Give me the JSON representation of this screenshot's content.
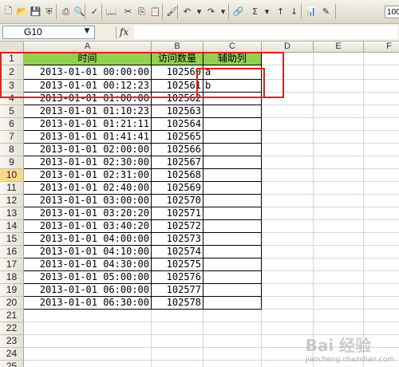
{
  "toolbar": {
    "buttons": [
      {
        "name": "new-icon",
        "glyph": "🗋"
      },
      {
        "name": "open-icon",
        "glyph": "📂"
      },
      {
        "name": "save-icon",
        "glyph": "💾"
      },
      {
        "name": "permission-icon",
        "glyph": "⛨"
      },
      {
        "name": "print-icon",
        "glyph": "⎙"
      },
      {
        "name": "print-preview-icon",
        "glyph": "🔍"
      },
      {
        "name": "spelling-icon",
        "glyph": "✓"
      },
      {
        "name": "research-icon",
        "glyph": "📖"
      },
      {
        "name": "cut-icon",
        "glyph": "✂"
      },
      {
        "name": "copy-icon",
        "glyph": "⎘"
      },
      {
        "name": "paste-icon",
        "glyph": "📋"
      },
      {
        "name": "format-painter-icon",
        "glyph": "🖌"
      },
      {
        "name": "undo-icon",
        "glyph": "↶"
      },
      {
        "name": "undo-dropdown-icon",
        "glyph": "▾"
      },
      {
        "name": "redo-icon",
        "glyph": "↷"
      },
      {
        "name": "redo-dropdown-icon",
        "glyph": "▾"
      },
      {
        "name": "hyperlink-icon",
        "glyph": "🔗"
      },
      {
        "name": "autosum-icon",
        "glyph": "Σ"
      },
      {
        "name": "autosum-dropdown-icon",
        "glyph": "▾"
      },
      {
        "name": "sort-ascending-icon",
        "glyph": "↑"
      },
      {
        "name": "sort-descending-icon",
        "glyph": "↓"
      },
      {
        "name": "chart-wizard-icon",
        "glyph": "📊"
      },
      {
        "name": "drawing-icon",
        "glyph": "✎"
      }
    ],
    "zoom": "100"
  },
  "formula_bar": {
    "name_box": "G10",
    "dropdown": "▼",
    "fx": "fx",
    "content": ""
  },
  "columns": [
    "A",
    "B",
    "C",
    "D",
    "E",
    "F"
  ],
  "headers": {
    "time": "时间",
    "visits": "访问数量",
    "helper": "辅助列"
  },
  "rows": [
    {
      "time": "2013-01-01 00:00:00",
      "visits": "102560",
      "helper": "a"
    },
    {
      "time": "2013-01-01 00:12:23",
      "visits": "102561",
      "helper": "b"
    },
    {
      "time": "2013-01-01 01:00:00",
      "visits": "102562",
      "helper": ""
    },
    {
      "time": "2013-01-01 01:10:23",
      "visits": "102563",
      "helper": ""
    },
    {
      "time": "2013-01-01 01:21:11",
      "visits": "102564",
      "helper": ""
    },
    {
      "time": "2013-01-01 01:41:41",
      "visits": "102565",
      "helper": ""
    },
    {
      "time": "2013-01-01 02:00:00",
      "visits": "102566",
      "helper": ""
    },
    {
      "time": "2013-01-01 02:30:00",
      "visits": "102567",
      "helper": ""
    },
    {
      "time": "2013-01-01 02:31:00",
      "visits": "102568",
      "helper": ""
    },
    {
      "time": "2013-01-01 02:40:00",
      "visits": "102569",
      "helper": ""
    },
    {
      "time": "2013-01-01 03:00:00",
      "visits": "102570",
      "helper": ""
    },
    {
      "time": "2013-01-01 03:20:20",
      "visits": "102571",
      "helper": ""
    },
    {
      "time": "2013-01-01 03:40:20",
      "visits": "102572",
      "helper": ""
    },
    {
      "time": "2013-01-01 04:00:00",
      "visits": "102573",
      "helper": ""
    },
    {
      "time": "2013-01-01 04:10:00",
      "visits": "102574",
      "helper": ""
    },
    {
      "time": "2013-01-01 04:30:00",
      "visits": "102575",
      "helper": ""
    },
    {
      "time": "2013-01-01 05:00:00",
      "visits": "102576",
      "helper": ""
    },
    {
      "time": "2013-01-01 06:00:00",
      "visits": "102577",
      "helper": ""
    },
    {
      "time": "2013-01-01 06:30:00",
      "visits": "102578",
      "helper": ""
    }
  ],
  "row_numbers": [
    "1",
    "2",
    "3",
    "4",
    "5",
    "6",
    "7",
    "8",
    "9",
    "10",
    "11",
    "12",
    "13",
    "14",
    "15",
    "16",
    "17",
    "18",
    "19",
    "20",
    "21",
    "22",
    "23",
    "24",
    "25"
  ],
  "active_row": "10",
  "colors": {
    "header_fill": "#92d050",
    "highlight": "#e0221b",
    "active_row_header": "#f8d88c"
  },
  "watermark": {
    "brand": "Bai 经验",
    "site": "jiaocheng.chazidian.com"
  }
}
